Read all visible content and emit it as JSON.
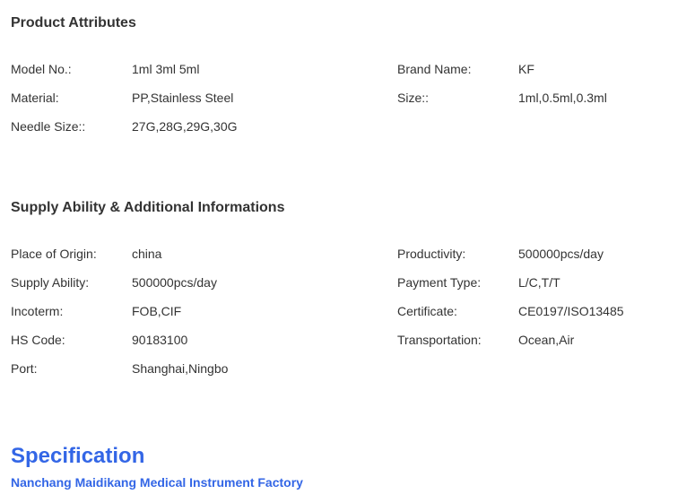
{
  "product_attributes": {
    "title": "Product Attributes",
    "left": [
      {
        "label": "Model No.:",
        "value": "1ml 3ml 5ml"
      },
      {
        "label": "Material:",
        "value": "PP,Stainless Steel"
      },
      {
        "label": "Needle Size::",
        "value": "27G,28G,29G,30G"
      }
    ],
    "right": [
      {
        "label": "Brand Name:",
        "value": "KF"
      },
      {
        "label": "Size::",
        "value": "1ml,0.5ml,0.3ml"
      }
    ]
  },
  "supply": {
    "title": "Supply Ability & Additional Informations",
    "left": [
      {
        "label": "Place of Origin:",
        "value": "china"
      },
      {
        "label": "Supply Ability:",
        "value": "500000pcs/day"
      },
      {
        "label": "Incoterm:",
        "value": "FOB,CIF"
      },
      {
        "label": "HS Code:",
        "value": "90183100"
      },
      {
        "label": "Port:",
        "value": "Shanghai,Ningbo"
      }
    ],
    "right": [
      {
        "label": "Productivity:",
        "value": "500000pcs/day"
      },
      {
        "label": "Payment Type:",
        "value": "L/C,T/T"
      },
      {
        "label": "Certificate:",
        "value": "CE0197/ISO13485"
      },
      {
        "label": "Transportation:",
        "value": "Ocean,Air"
      }
    ]
  },
  "specification": {
    "title": "Specification",
    "subtitle": "Nanchang Maidikang Medical Instrument Factory"
  },
  "colors": {
    "text": "#333333",
    "accent": "#3366e6"
  }
}
